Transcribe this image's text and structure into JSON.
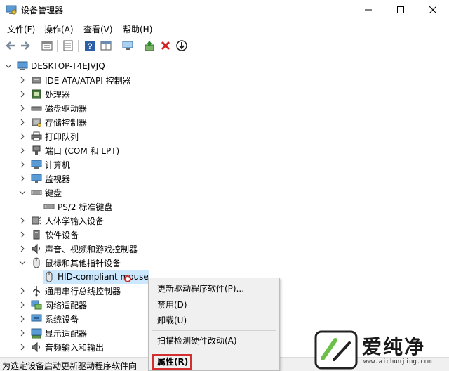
{
  "window": {
    "title": "设备管理器"
  },
  "menu": [
    "文件(F)",
    "操作(A)",
    "查看(V)",
    "帮助(H)"
  ],
  "toolbar": {
    "buttons": [
      "back-icon",
      "forward-icon",
      "properties-icon",
      "view-icon",
      "help-icon",
      "grid-icon",
      "monitor-icon",
      "update-driver-icon",
      "uninstall-icon",
      "scan-icon"
    ]
  },
  "tree": {
    "root": "DESKTOP-T4EJVJQ",
    "items": [
      {
        "label": "IDE ATA/ATAPI 控制器"
      },
      {
        "label": "处理器"
      },
      {
        "label": "磁盘驱动器"
      },
      {
        "label": "存储控制器"
      },
      {
        "label": "打印队列"
      },
      {
        "label": "端口 (COM 和 LPT)"
      },
      {
        "label": "计算机"
      },
      {
        "label": "监视器"
      },
      {
        "label": "键盘"
      },
      {
        "label": "PS/2 标准键盘"
      },
      {
        "label": "人体学输入设备"
      },
      {
        "label": "软件设备"
      },
      {
        "label": "声音、视频和游戏控制器"
      },
      {
        "label": "鼠标和其他指针设备"
      },
      {
        "label": "HID-compliant mouse"
      },
      {
        "label": "通用串行总线控制器"
      },
      {
        "label": "网络适配器"
      },
      {
        "label": "系统设备"
      },
      {
        "label": "显示适配器"
      },
      {
        "label": "音频输入和输出"
      }
    ]
  },
  "context_menu": {
    "items": [
      "更新驱动程序软件(P)...",
      "禁用(D)",
      "卸载(U)",
      "扫描检测硬件改动(A)",
      "属性(R)"
    ]
  },
  "status": {
    "text": "为选定设备启动更新驱动程序软件向"
  },
  "watermark": {
    "text": "爱纯净",
    "url": "www.aichunjing.com"
  },
  "colors": {
    "selection": "#cce8ff",
    "highlight_border": "#d32f2f",
    "accent": "#1e7fd8"
  }
}
